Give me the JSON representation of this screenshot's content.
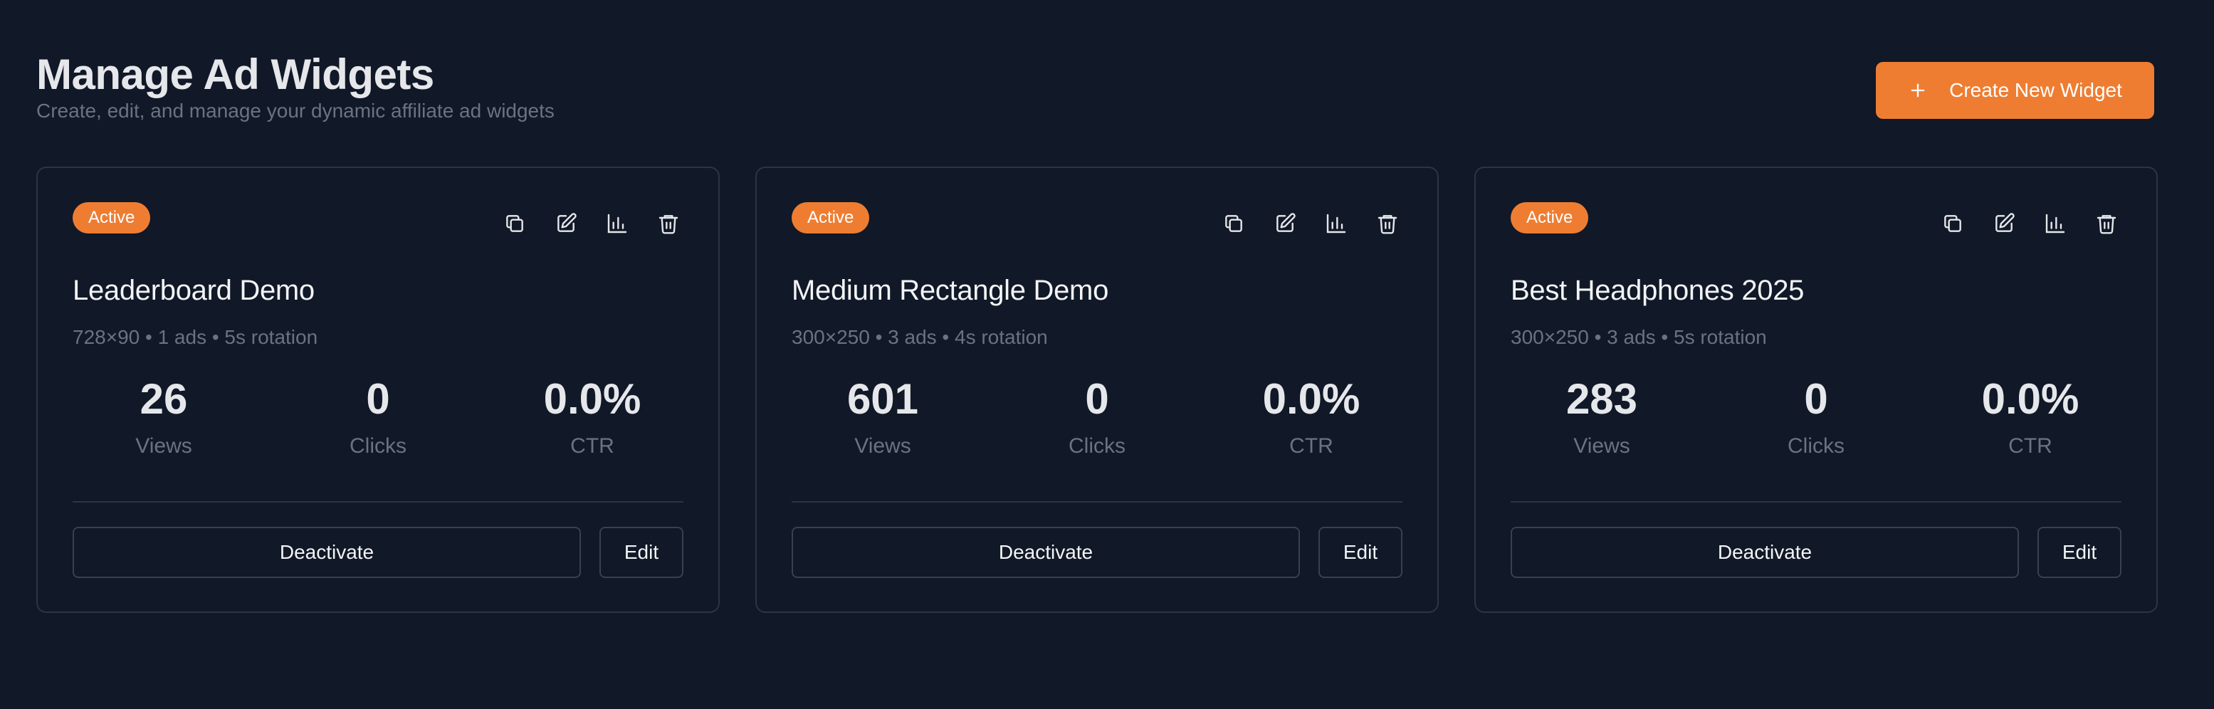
{
  "header": {
    "title": "Manage Ad Widgets",
    "subtitle": "Create, edit, and manage your dynamic affiliate ad widgets",
    "create_button_label": "Create New Widget"
  },
  "colors": {
    "background": "#111827",
    "accent": "#ee7d32",
    "border": "#2c3544",
    "muted_text": "#6b7280"
  },
  "icons": {
    "create": "plus-icon",
    "card_actions": [
      "copy-icon",
      "edit-icon",
      "analytics-icon",
      "trash-icon"
    ]
  },
  "widgets": [
    {
      "status": "Active",
      "title": "Leaderboard Demo",
      "meta": "728×90 • 1 ads • 5s rotation",
      "stats": [
        {
          "value": "26",
          "label": "Views"
        },
        {
          "value": "0",
          "label": "Clicks"
        },
        {
          "value": "0.0%",
          "label": "CTR"
        }
      ],
      "deactivate_label": "Deactivate",
      "edit_label": "Edit"
    },
    {
      "status": "Active",
      "title": "Medium Rectangle Demo",
      "meta": "300×250 • 3 ads • 4s rotation",
      "stats": [
        {
          "value": "601",
          "label": "Views"
        },
        {
          "value": "0",
          "label": "Clicks"
        },
        {
          "value": "0.0%",
          "label": "CTR"
        }
      ],
      "deactivate_label": "Deactivate",
      "edit_label": "Edit"
    },
    {
      "status": "Active",
      "title": "Best Headphones 2025",
      "meta": "300×250 • 3 ads • 5s rotation",
      "stats": [
        {
          "value": "283",
          "label": "Views"
        },
        {
          "value": "0",
          "label": "Clicks"
        },
        {
          "value": "0.0%",
          "label": "CTR"
        }
      ],
      "deactivate_label": "Deactivate",
      "edit_label": "Edit"
    }
  ]
}
